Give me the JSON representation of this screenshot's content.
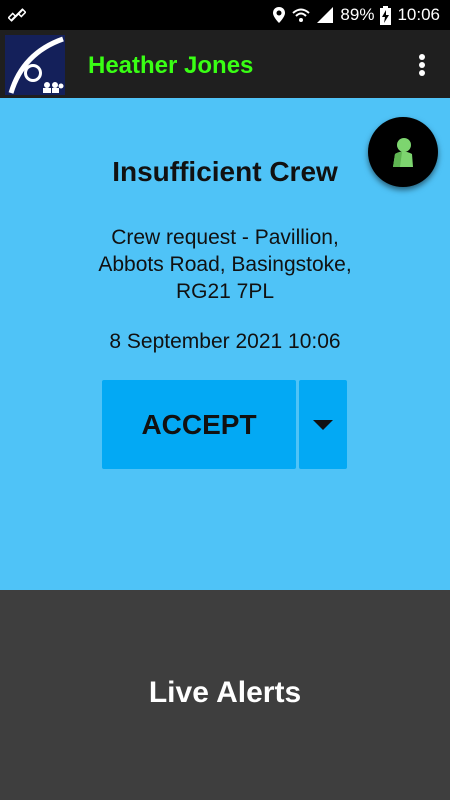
{
  "status_bar": {
    "battery": "89%",
    "time": "10:06"
  },
  "app_bar": {
    "user_name": "Heather Jones",
    "user_name_color": "#39ff14"
  },
  "alert": {
    "title": "Insufficient Crew",
    "address_line1": "Crew request - Pavillion,",
    "address_line2": "Abbots Road, Basingstoke,",
    "address_line3": "RG21 7PL",
    "datetime": "8 September 2021 10:06",
    "accept_label": "ACCEPT",
    "panel_color": "#4fc3f7",
    "button_color": "#03a9f4"
  },
  "bottom": {
    "title": "Live Alerts"
  },
  "icons": {
    "status_left": "satellite-icon",
    "location": "location-icon",
    "wifi": "wifi-icon",
    "signal": "signal-icon",
    "battery": "battery-charging-icon",
    "overflow": "more-vert-icon",
    "dropdown": "arrow-drop-down-icon",
    "fab": "person-icon"
  }
}
